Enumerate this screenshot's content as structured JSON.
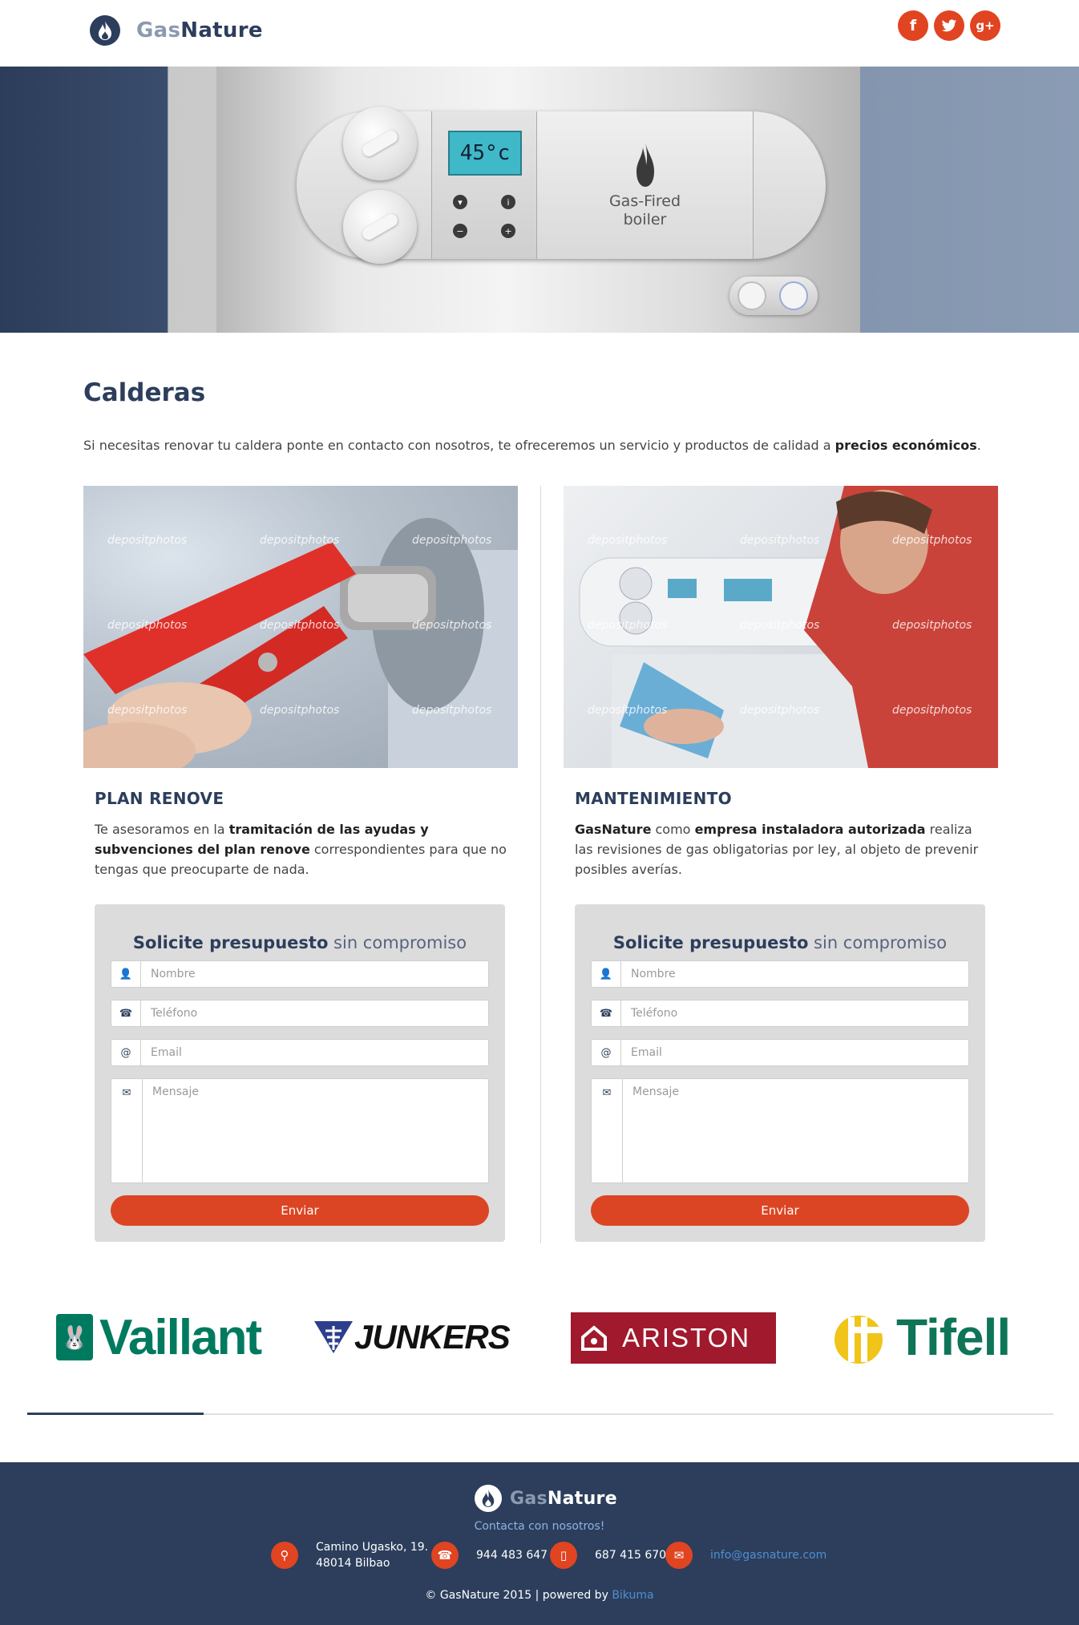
{
  "brand": {
    "gas": "Gas",
    "nature": "Nature"
  },
  "social": [
    {
      "icon": "facebook-icon",
      "glyph": "f"
    },
    {
      "icon": "twitter-icon",
      "glyph": "t"
    },
    {
      "icon": "google-plus-icon",
      "glyph": "g+"
    }
  ],
  "hero": {
    "lcd": "45°c",
    "label": "Gas-Fired boiler"
  },
  "main": {
    "title": "Calderas",
    "intro_prefix": "Si necesitas renovar tu caldera ponte en contacto con nosotros, te ofreceremos un servicio y productos de calidad a ",
    "intro_bold": "precios económicos",
    "intro_suffix": "."
  },
  "watermark": "depositphotos",
  "columns": [
    {
      "title": "PLAN RENOVE",
      "text": {
        "a": "Te asesoramos en la ",
        "b": "tramitación de las ayudas y subvenciones del plan renove",
        "c": " correspondientes para que no tengas que preocuparte de nada."
      }
    },
    {
      "title": "MANTENIMIENTO",
      "text": {
        "a": "GasNature",
        "b": " como ",
        "c": "empresa instaladora autorizada",
        "d": " realiza las revisiones de gas obligatorias por ley, al objeto de prevenir posibles averías."
      }
    }
  ],
  "form": {
    "title_bold": "Solicite presupuesto",
    "title_light": " sin compromiso",
    "name_placeholder": "Nombre",
    "phone_placeholder": "Teléfono",
    "email_placeholder": "Email",
    "message_placeholder": "Mensaje",
    "submit": "Enviar"
  },
  "brands": [
    "Vaillant",
    "JUNKERS",
    "ARISTON",
    "Tifell"
  ],
  "footer": {
    "contact_title": "Contacta con nosotros!",
    "address_line1": "Camino Ugasko, 19.",
    "address_line2": "48014 Bilbao",
    "phone1": "944 483 647",
    "phone2": "687 415 670",
    "email": "info@gasnature.com",
    "copyright": "© GasNature 2015 | powered by ",
    "powered": "Bikuma"
  },
  "colors": {
    "navy": "#2c3e5c",
    "accent": "#e04421",
    "link": "#4f8fd0"
  }
}
